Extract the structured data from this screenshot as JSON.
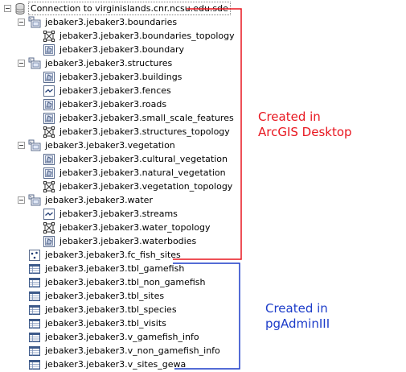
{
  "tree": {
    "connection": {
      "label": "Connection to virginislands.cnr.ncsu.edu.sde",
      "icon": "database-connection-icon"
    },
    "groups": [
      {
        "label": "jebaker3.jebaker3.boundaries",
        "icon": "feature-dataset-icon",
        "children": [
          {
            "label": "jebaker3.jebaker3.boundaries_topology",
            "icon": "topology-icon"
          },
          {
            "label": "jebaker3.jebaker3.boundary",
            "icon": "polygon-feature-class-icon"
          }
        ]
      },
      {
        "label": "jebaker3.jebaker3.structures",
        "icon": "feature-dataset-icon",
        "children": [
          {
            "label": "jebaker3.jebaker3.buildings",
            "icon": "polygon-feature-class-icon"
          },
          {
            "label": "jebaker3.jebaker3.fences",
            "icon": "line-feature-class-icon"
          },
          {
            "label": "jebaker3.jebaker3.roads",
            "icon": "polygon-feature-class-icon"
          },
          {
            "label": "jebaker3.jebaker3.small_scale_features",
            "icon": "polygon-feature-class-icon"
          },
          {
            "label": "jebaker3.jebaker3.structures_topology",
            "icon": "topology-icon"
          }
        ]
      },
      {
        "label": "jebaker3.jebaker3.vegetation",
        "icon": "feature-dataset-icon",
        "children": [
          {
            "label": "jebaker3.jebaker3.cultural_vegetation",
            "icon": "polygon-feature-class-icon"
          },
          {
            "label": "jebaker3.jebaker3.natural_vegetation",
            "icon": "polygon-feature-class-icon"
          },
          {
            "label": "jebaker3.jebaker3.vegetation_topology",
            "icon": "topology-icon"
          }
        ]
      },
      {
        "label": "jebaker3.jebaker3.water",
        "icon": "feature-dataset-icon",
        "children": [
          {
            "label": "jebaker3.jebaker3.streams",
            "icon": "line-feature-class-icon"
          },
          {
            "label": "jebaker3.jebaker3.water_topology",
            "icon": "topology-icon"
          },
          {
            "label": "jebaker3.jebaker3.waterbodies",
            "icon": "polygon-feature-class-icon"
          }
        ]
      }
    ],
    "standalone": [
      {
        "label": "jebaker3.jebaker3.fc_fish_sites",
        "icon": "point-feature-class-icon"
      },
      {
        "label": "jebaker3.jebaker3.tbl_gamefish",
        "icon": "table-icon"
      },
      {
        "label": "jebaker3.jebaker3.tbl_non_gamefish",
        "icon": "table-icon"
      },
      {
        "label": "jebaker3.jebaker3.tbl_sites",
        "icon": "table-icon"
      },
      {
        "label": "jebaker3.jebaker3.tbl_species",
        "icon": "table-icon"
      },
      {
        "label": "jebaker3.jebaker3.tbl_visits",
        "icon": "table-icon"
      },
      {
        "label": "jebaker3.jebaker3.v_gamefish_info",
        "icon": "table-icon"
      },
      {
        "label": "jebaker3.jebaker3.v_non_gamefish_info",
        "icon": "table-icon"
      },
      {
        "label": "jebaker3.jebaker3.v_sites_gewa",
        "icon": "table-icon"
      }
    ]
  },
  "annotations": {
    "arcgis": {
      "line1": "Created in",
      "line2": "ArcGIS Desktop",
      "color": "#e8161f"
    },
    "pgadmin": {
      "line1": "Created in",
      "line2": "pgAdminIII",
      "color": "#1c3cc9"
    }
  }
}
